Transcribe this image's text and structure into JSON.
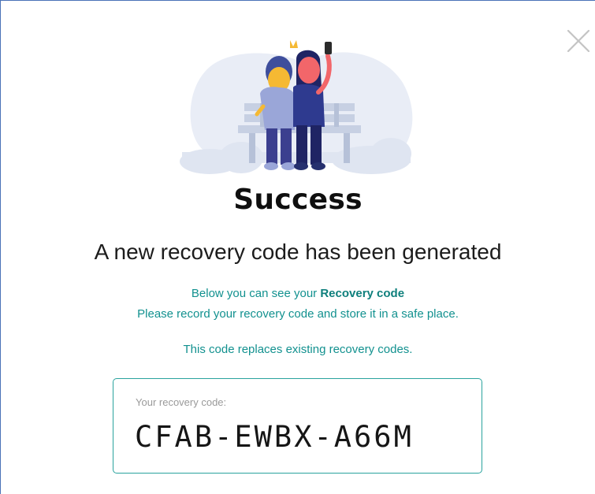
{
  "dialog": {
    "close_icon": "close-icon",
    "illustration_icon": "couple-selfie-illustration",
    "title": "Success",
    "subtitle": "A new recovery code has been generated",
    "info_line1_prefix": "Below you can see your ",
    "info_line1_emphasis": "Recovery code",
    "info_line2": "Please record your recovery code and store it in a safe place.",
    "info_line3": "This code replaces existing recovery codes.",
    "code_label": "Your recovery code:",
    "code_value": "CFAB-EWBX-A66M"
  },
  "colors": {
    "accent_teal": "#12918f",
    "border_teal": "#2aa39e",
    "title_text": "#0f0f0f"
  }
}
